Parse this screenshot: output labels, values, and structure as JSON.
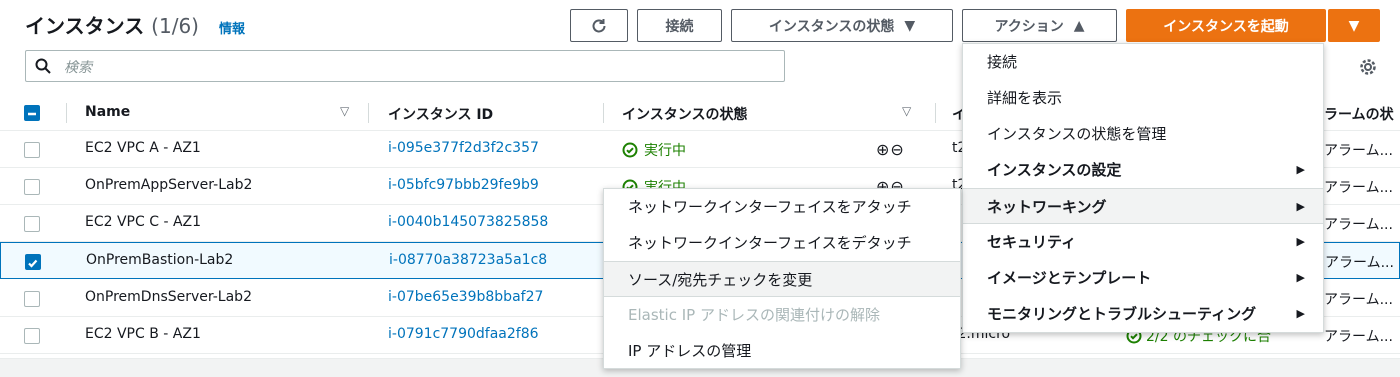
{
  "header": {
    "title": "インスタンス",
    "count": "(1/6)",
    "info": "情報"
  },
  "toolbar": {
    "connect": "接続",
    "instance_state": "インスタンスの状態",
    "actions": "アクション",
    "launch": "インスタンスを起動"
  },
  "search": {
    "placeholder": "検索"
  },
  "table": {
    "headers": {
      "name": "Name",
      "instance_id": "インスタンス ID",
      "state": "インスタンスの状態",
      "type": "イ",
      "alarm": "ラームの状"
    },
    "rows": [
      {
        "name": "EC2 VPC A - AZ1",
        "id": "i-095e377f2d3f2c357",
        "state": "実行中",
        "type": "t2",
        "alarm": "アラーム..."
      },
      {
        "name": "OnPremAppServer-Lab2",
        "id": "i-05bfc97bbb29fe9b9",
        "state": "実行中",
        "type": "t2",
        "alarm": "アラーム..."
      },
      {
        "name": "EC2 VPC C - AZ1",
        "id": "i-0040b145073825858",
        "state": "",
        "type": "",
        "alarm": "アラーム..."
      },
      {
        "name": "OnPremBastion-Lab2",
        "id": "i-08770a38723a5a1c8",
        "state": "",
        "type": "",
        "alarm": "アラーム..."
      },
      {
        "name": "OnPremDnsServer-Lab2",
        "id": "i-07be65e39b8bbaf27",
        "state": "",
        "type": "",
        "alarm": "アラーム..."
      },
      {
        "name": "EC2 VPC B - AZ1",
        "id": "i-0791c7790dfaa2f86",
        "state": "",
        "type": "t2.micro",
        "alarm": "アラーム...",
        "check": "2/2 のチェックに合"
      }
    ]
  },
  "actions_menu": {
    "items": [
      {
        "label": "接続"
      },
      {
        "label": "詳細を表示"
      },
      {
        "label": "インスタンスの状態を管理"
      },
      {
        "label": "インスタンスの設定"
      },
      {
        "label": "ネットワーキング"
      },
      {
        "label": "セキュリティ"
      },
      {
        "label": "イメージとテンプレート"
      },
      {
        "label": "モニタリングとトラブルシューティング"
      }
    ]
  },
  "networking_submenu": {
    "items": [
      {
        "label": "ネットワークインターフェイスをアタッチ"
      },
      {
        "label": "ネットワークインターフェイスをデタッチ"
      },
      {
        "label": "ソース/宛先チェックを変更"
      },
      {
        "label": "Elastic IP アドレスの関連付けの解除"
      },
      {
        "label": "IP アドレスの管理"
      }
    ]
  },
  "colors": {
    "primary": "#ec7211",
    "link": "#0073bb",
    "success": "#1d8102"
  }
}
